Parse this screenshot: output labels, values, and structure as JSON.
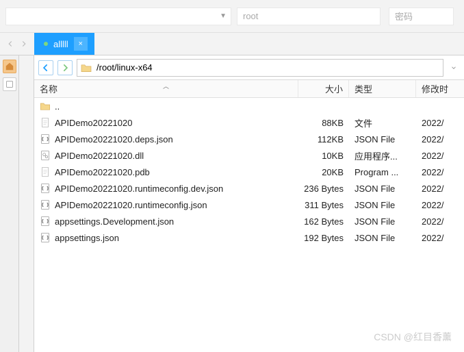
{
  "toolbar": {
    "root_placeholder": "root",
    "password_placeholder": "密码",
    "dropdown_caret": "▼"
  },
  "tab": {
    "label": "alllll",
    "close": "×"
  },
  "path": {
    "value": "/root/linux-x64"
  },
  "columns": {
    "name": "名称",
    "size": "大小",
    "type": "类型",
    "modified": "修改时",
    "sort_indicator": "︿"
  },
  "files": [
    {
      "icon": "folder-up",
      "name": "..",
      "size": "",
      "type": "",
      "date": ""
    },
    {
      "icon": "file",
      "name": "APIDemo20221020",
      "size": "88KB",
      "type": "文件",
      "date": "2022/"
    },
    {
      "icon": "json",
      "name": "APIDemo20221020.deps.json",
      "size": "112KB",
      "type": "JSON File",
      "date": "2022/"
    },
    {
      "icon": "dll",
      "name": "APIDemo20221020.dll",
      "size": "10KB",
      "type": "应用程序...",
      "date": "2022/"
    },
    {
      "icon": "file",
      "name": "APIDemo20221020.pdb",
      "size": "20KB",
      "type": "Program ...",
      "date": "2022/"
    },
    {
      "icon": "json",
      "name": "APIDemo20221020.runtimeconfig.dev.json",
      "size": "236 Bytes",
      "type": "JSON File",
      "date": "2022/"
    },
    {
      "icon": "json",
      "name": "APIDemo20221020.runtimeconfig.json",
      "size": "311 Bytes",
      "type": "JSON File",
      "date": "2022/"
    },
    {
      "icon": "json",
      "name": "appsettings.Development.json",
      "size": "162 Bytes",
      "type": "JSON File",
      "date": "2022/"
    },
    {
      "icon": "json",
      "name": "appsettings.json",
      "size": "192 Bytes",
      "type": "JSON File",
      "date": "2022/"
    }
  ],
  "watermark": "CSDN @红目香薰"
}
